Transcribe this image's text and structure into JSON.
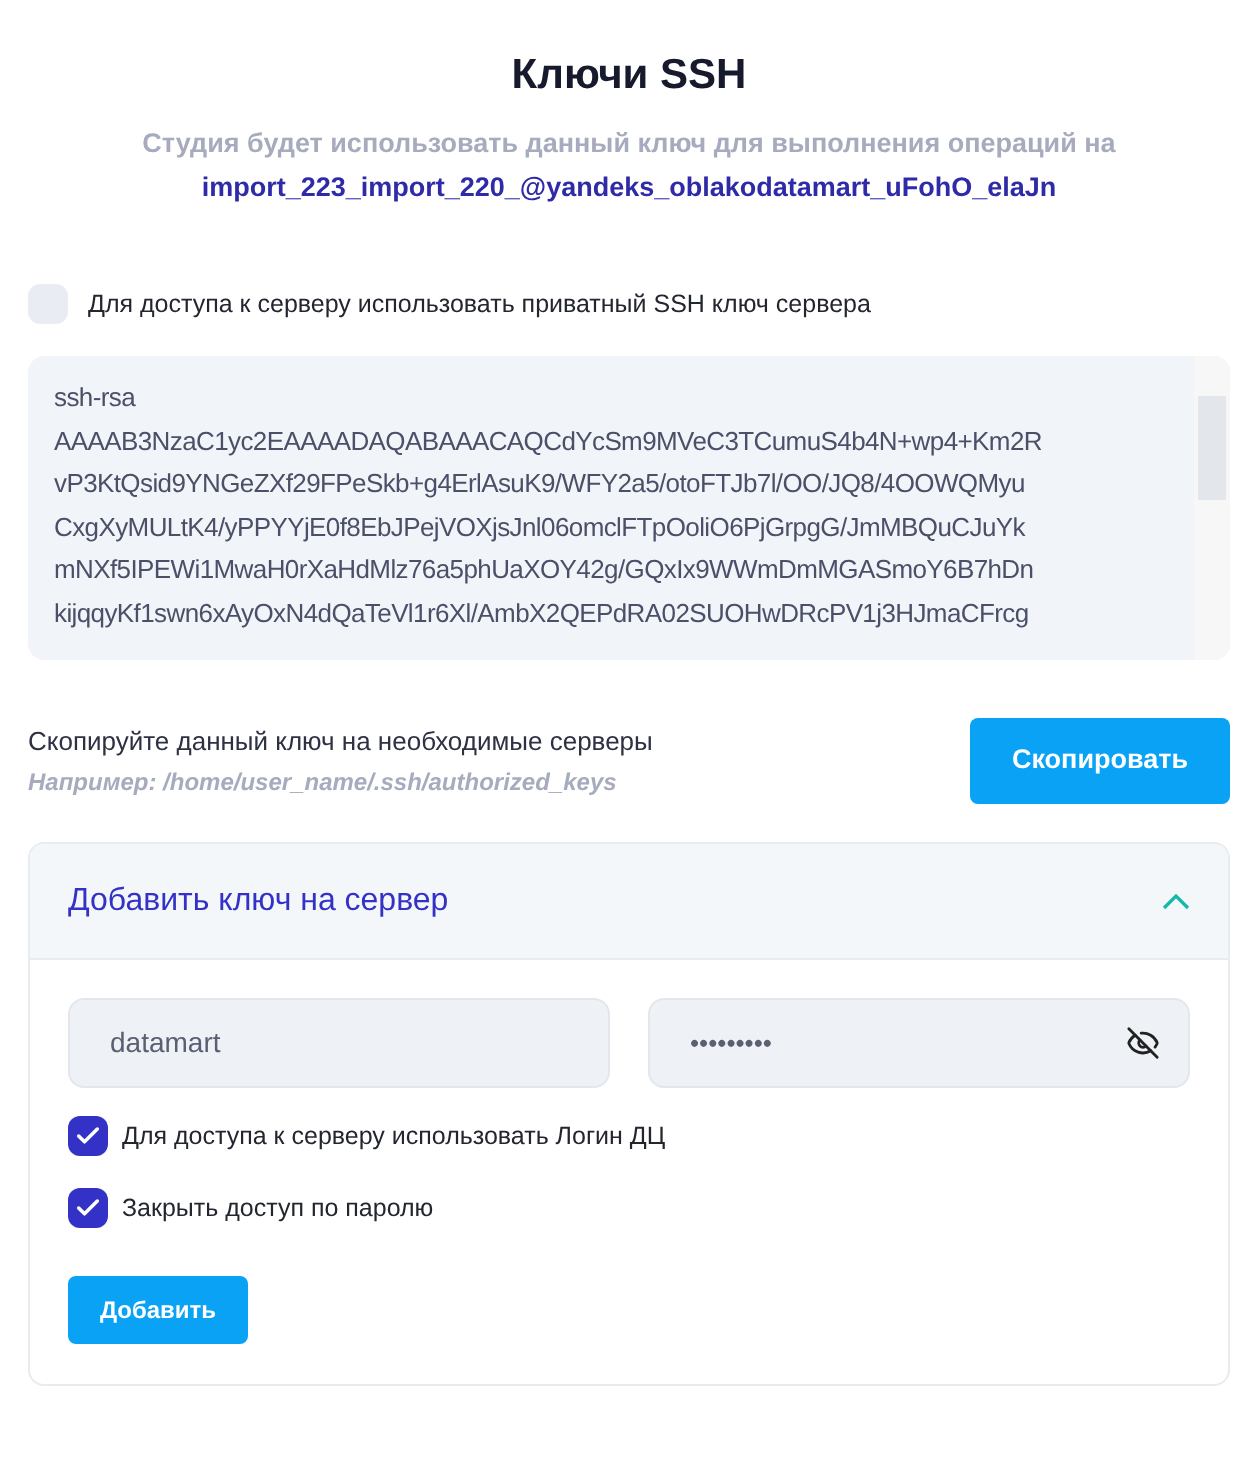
{
  "title": "Ключи SSH",
  "subtitle": "Студия будет использовать данный ключ для выполнения операций на",
  "project": "import_223_import_220_@yandeks_oblakodatamart_uFohO_elaJn",
  "private_key_option": {
    "label": "Для доступа к серверу использовать приватный SSH ключ сервера",
    "checked": false
  },
  "key_lines": [
    "ssh-rsa",
    "AAAAB3NzaC1yc2EAAAADAQABAAACAQCdYcSm9MVeC3TCumuS4b4N+wp4+Km2R",
    "vP3KtQsid9YNGeZXf29FPeSkb+g4ErlAsuK9/WFY2a5/otoFTJb7l/OO/JQ8/4OOWQMyu",
    "CxgXyMULtK4/yPPYYjE0f8EbJPejVOXjsJnl06omclFTpOoliO6PjGrpgG/JmMBQuCJuYk",
    "mNXf5IPEWi1MwaH0rXaHdMlz76a5phUaXOY42g/GQxIx9WWmDmMGASmoY6B7hDn",
    "kijqqyKf1swn6xAyOxN4dQaTeVl1r6Xl/AmbX2QEPdRA02SUOHwDRcPV1j3HJmaCFrcg"
  ],
  "copy_hint": "Скопируйте данный ключ на необходимые серверы",
  "copy_example": "Например: /home/user_name/.ssh/authorized_keys",
  "copy_button": "Скопировать",
  "add_panel": {
    "title": "Добавить ключ на сервер",
    "expanded": true,
    "login": "datamart",
    "password": "•••••••••",
    "options": [
      {
        "label": "Для доступа к серверу использовать Логин ДЦ",
        "checked": true
      },
      {
        "label": "Закрыть доступ по паролю",
        "checked": true
      }
    ],
    "button": "Добавить"
  }
}
